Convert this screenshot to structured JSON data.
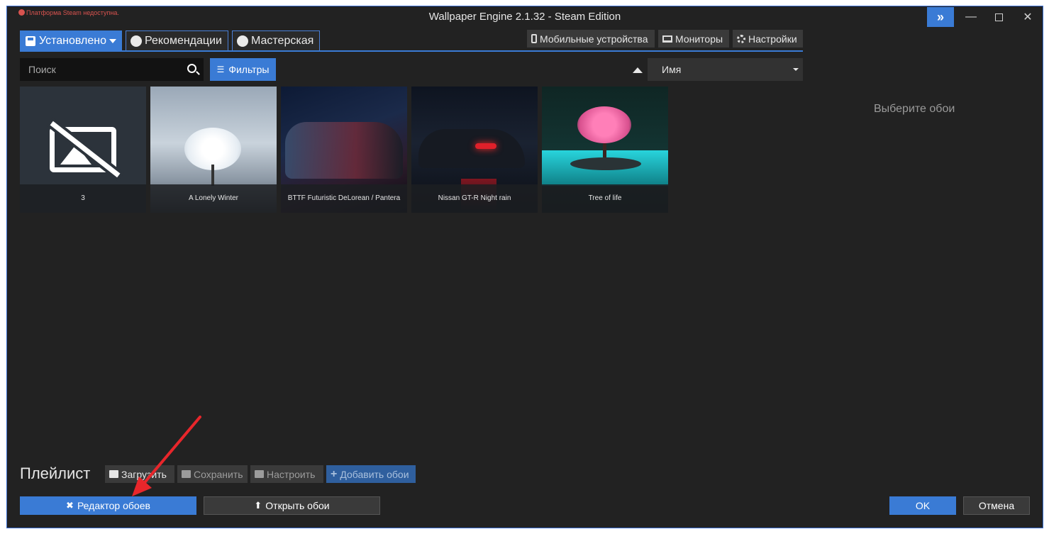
{
  "window": {
    "title": "Wallpaper Engine 2.1.32 - Steam Edition",
    "steam_warning": "Платформа Steam недоступна."
  },
  "tabs": [
    {
      "label": "Установлено",
      "icon": "floppy-icon",
      "active": true
    },
    {
      "label": "Рекомендации",
      "icon": "compass-icon",
      "active": false
    },
    {
      "label": "Мастерская",
      "icon": "steam-icon",
      "active": false
    }
  ],
  "top_buttons": {
    "mobile": "Мобильные устройства",
    "monitors": "Мониторы",
    "settings": "Настройки"
  },
  "search": {
    "placeholder": "Поиск",
    "value": ""
  },
  "filters_label": "Фильтры",
  "sort": {
    "selected": "Имя",
    "direction": "ascending"
  },
  "wallpapers": [
    {
      "title": "3",
      "preview": "no-image"
    },
    {
      "title": "A Lonely Winter",
      "preview": "snowy-tree"
    },
    {
      "title": "BTTF Futuristic DeLorean / Pantera",
      "preview": "neon-car"
    },
    {
      "title": "Nissan GT-R Night rain",
      "preview": "night-car"
    },
    {
      "title": "Tree of life",
      "preview": "pink-tree"
    }
  ],
  "details_hint": "Выберите обои",
  "playlist": {
    "title": "Плейлист",
    "load": "Загрузить",
    "save": "Сохранить",
    "configure": "Настроить",
    "add": "Добавить обои"
  },
  "footer": {
    "editor": "Редактор обоев",
    "open": "Открыть обои",
    "ok": "OK",
    "cancel": "Отмена"
  },
  "colors": {
    "accent": "#3a7bd5",
    "background": "#222222",
    "annotation_arrow": "#e8262b"
  }
}
